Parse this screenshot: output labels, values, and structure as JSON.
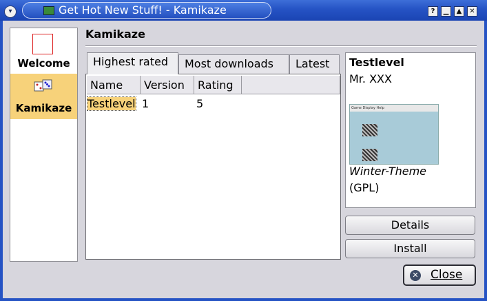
{
  "window": {
    "title": "Get Hot New Stuff! - Kamikaze",
    "controls": {
      "help": "?",
      "minimize": "▁",
      "maximize": "▲",
      "close": "✕"
    }
  },
  "nav": {
    "items": [
      {
        "label": "Welcome",
        "icon": "welcome-icon",
        "selected": false
      },
      {
        "label": "Kamikaze",
        "icon": "dice-icon",
        "selected": true
      }
    ]
  },
  "page": {
    "title": "Kamikaze"
  },
  "tabs": [
    {
      "label": "Highest rated",
      "active": true
    },
    {
      "label": "Most downloads",
      "active": false
    },
    {
      "label": "Latest",
      "active": false
    }
  ],
  "table": {
    "columns": [
      "Name",
      "Version",
      "Rating"
    ],
    "rows": [
      {
        "name": "Testlevel",
        "version": "1",
        "rating": "5"
      }
    ]
  },
  "details": {
    "name": "Testlevel",
    "author": "Mr. XXX",
    "preview_menu": "Game  Display  Help",
    "description": "Winter-Theme",
    "license": "(GPL)"
  },
  "buttons": {
    "details": "Details",
    "install": "Install",
    "close": "Close"
  },
  "colors": {
    "titlebar": "#2553c4",
    "selection": "#f7d27a"
  }
}
